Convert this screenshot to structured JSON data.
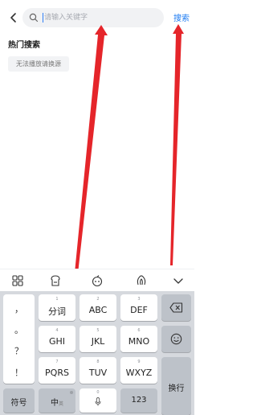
{
  "search": {
    "placeholder": "请输入关键字",
    "button_label": "搜索"
  },
  "hot": {
    "title": "热门搜索",
    "tags": [
      "无法播放请换源"
    ]
  },
  "toolbar": {
    "icons": [
      "grid-icon",
      "skin-icon",
      "voice-bot-icon",
      "swipe-icon",
      "collapse-icon"
    ]
  },
  "keyboard": {
    "symbols": [
      "，",
      "。",
      "？",
      "！"
    ],
    "keys": [
      {
        "label": "分词",
        "num": "1"
      },
      {
        "label": "ABC",
        "num": "2"
      },
      {
        "label": "DEF",
        "num": "3"
      },
      {
        "label": "GHI",
        "num": "4"
      },
      {
        "label": "JKL",
        "num": "5"
      },
      {
        "label": "MNO",
        "num": "6"
      },
      {
        "label": "PQRS",
        "num": "7"
      },
      {
        "label": "TUV",
        "num": "8"
      },
      {
        "label": "WXYZ",
        "num": "9"
      }
    ],
    "bottom": {
      "symbol_key": "符号",
      "lang_key": "中",
      "lang_sub": "英",
      "space_num": "0",
      "num_key": "123",
      "enter_key": "换行"
    }
  },
  "colors": {
    "accent": "#1e7cf2",
    "arrow": "#e5252a",
    "keyboard_bg": "#d6d9de"
  }
}
